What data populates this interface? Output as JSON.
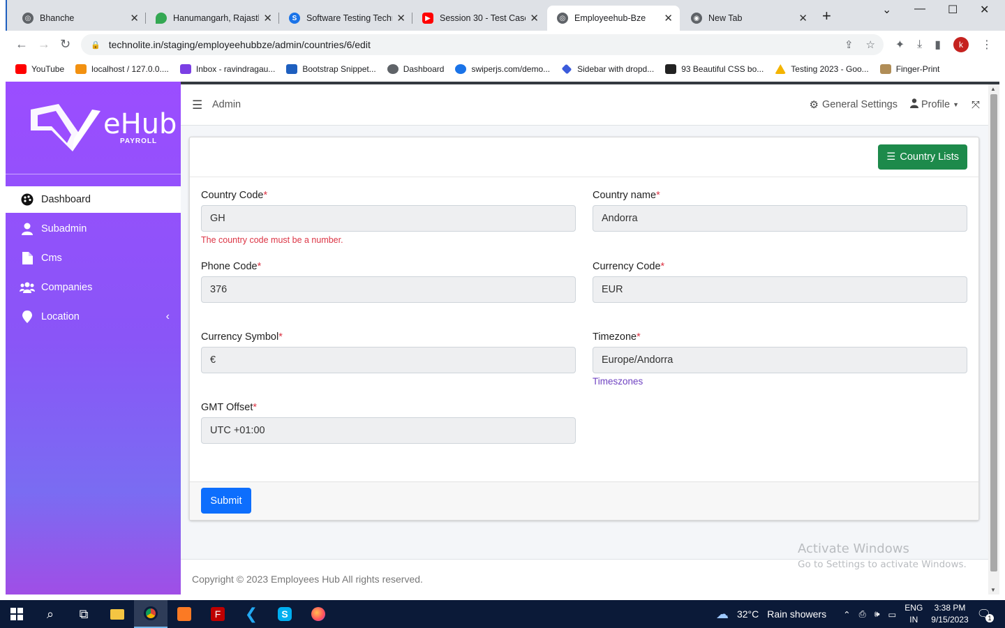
{
  "browser": {
    "tabs": [
      {
        "title": "Bhanche",
        "favicon": "globe-icon",
        "color": "#5f6368"
      },
      {
        "title": "Hanumangarh, Rajasthan",
        "favicon": "maps-pin-icon",
        "color": "#34a853"
      },
      {
        "title": "Software Testing Techniques",
        "favicon": "blue-site-icon",
        "color": "#1a73e8"
      },
      {
        "title": "Session 30 - Test Case Ex",
        "favicon": "youtube-icon",
        "color": "#ff0000"
      },
      {
        "title": "Employeehub-Bze",
        "favicon": "globe-icon",
        "color": "#5f6368"
      },
      {
        "title": "New Tab",
        "favicon": "chrome-icon",
        "color": "#5f6368"
      }
    ],
    "url": "technolite.in/staging/employeehubbze/admin/countries/6/edit",
    "profile_initial": "k",
    "bookmarks": [
      {
        "label": "YouTube",
        "color": "#ff0000"
      },
      {
        "label": "localhost / 127.0.0....",
        "color": "#f29111"
      },
      {
        "label": "Inbox - ravindragau...",
        "color": "#7b3fe4"
      },
      {
        "label": "Bootstrap Snippet...",
        "color": "#1e5fbf"
      },
      {
        "label": "Dashboard",
        "color": "#5f6368"
      },
      {
        "label": "swiperjs.com/demo...",
        "color": "#1a73e8"
      },
      {
        "label": "Sidebar with dropd...",
        "color": "#3b5bdb"
      },
      {
        "label": "93 Beautiful CSS bo...",
        "color": "#222222"
      },
      {
        "label": "Testing 2023 - Goo...",
        "color": "#f4b400"
      },
      {
        "label": "Finger-Print",
        "color": "#b08d57"
      }
    ]
  },
  "sidebar": {
    "logo_text": "eHub",
    "logo_sub": "PAYROLL",
    "items": [
      {
        "label": "Dashboard",
        "icon": "palette-icon"
      },
      {
        "label": "Subadmin",
        "icon": "user-icon"
      },
      {
        "label": "Cms",
        "icon": "file-icon"
      },
      {
        "label": "Companies",
        "icon": "users-icon"
      },
      {
        "label": "Location",
        "icon": "map-marker-icon"
      }
    ]
  },
  "topnav": {
    "section": "Admin",
    "general_settings": "General Settings",
    "profile": "Profile"
  },
  "form": {
    "list_button": "Country Lists",
    "country_code": {
      "label": "Country Code",
      "value": "GH",
      "error": "The country code must be a number."
    },
    "country_name": {
      "label": "Country name",
      "value": "Andorra"
    },
    "phone_code": {
      "label": "Phone Code",
      "value": "376"
    },
    "currency_code": {
      "label": "Currency Code",
      "value": "EUR"
    },
    "currency_symbol": {
      "label": "Currency Symbol",
      "value": "€"
    },
    "timezone": {
      "label": "Timezone",
      "value": "Europe/Andorra",
      "link": "Timeszones"
    },
    "gmt_offset": {
      "label": "GMT Offset",
      "value": "UTC +01:00"
    },
    "submit": "Submit"
  },
  "footer": {
    "copyright": "Copyright © 2023 Employees Hub All rights reserved."
  },
  "watermark": {
    "line1": "Activate Windows",
    "line2": "Go to Settings to activate Windows."
  },
  "taskbar": {
    "weather_temp": "32°C",
    "weather_text": "Rain showers",
    "lang1": "ENG",
    "lang2": "IN",
    "time": "3:38 PM",
    "date": "9/15/2023",
    "notification_count": "1"
  }
}
